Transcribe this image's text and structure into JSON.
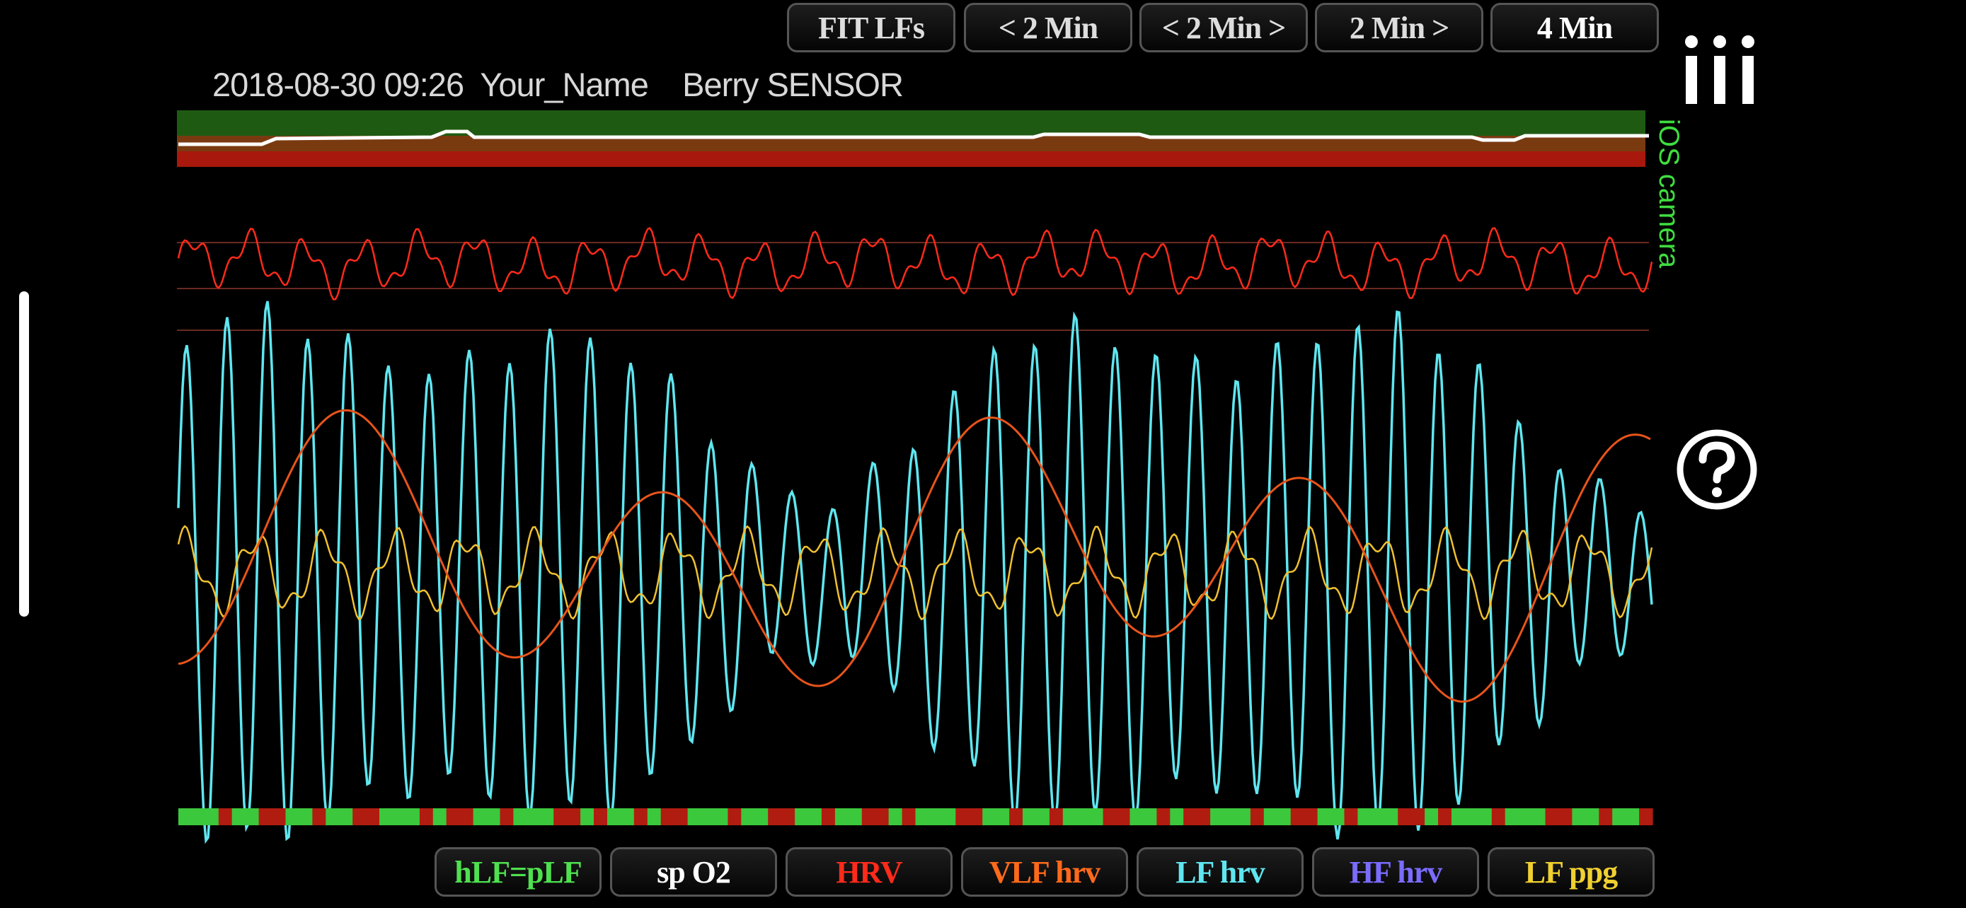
{
  "toolbar": {
    "buttons": [
      {
        "label": "FIT LFs",
        "color": "#dddddd"
      },
      {
        "label": "< 2 Min",
        "color": "#dddddd"
      },
      {
        "label": "< 2 Min >",
        "color": "#dddddd"
      },
      {
        "label": "2 Min >",
        "color": "#dddddd"
      },
      {
        "label": "4 Min",
        "color": "#ffffff"
      }
    ]
  },
  "header": {
    "timestamp": "2018-08-30 09:26",
    "user": "Your_Name",
    "sensor": "Berry SENSOR"
  },
  "side": {
    "camera_label": "iOS camera",
    "menu_icon": "menu-icon",
    "help_icon": "question-mark-icon"
  },
  "legend": {
    "buttons": [
      {
        "label": "hLF=pLF",
        "color": "#4fe04f"
      },
      {
        "label": "sp O2",
        "color": "#ffffff"
      },
      {
        "label": "HRV",
        "color": "#ff2a1a"
      },
      {
        "label": "VLF hrv",
        "color": "#ff6a1a"
      },
      {
        "label": "LF hrv",
        "color": "#5fe6f0"
      },
      {
        "label": "HF hrv",
        "color": "#7a6cff"
      },
      {
        "label": "LF ppg",
        "color": "#f0d030"
      }
    ]
  },
  "colors": {
    "spo2_band_green": "#1f5a12",
    "spo2_band_brown": "#7a3a10",
    "spo2_band_red": "#a8180c",
    "hrv": "#ff2a1a",
    "vlf": "#e8541a",
    "lf_hrv": "#5fe6f0",
    "lf_ppg": "#f0c030",
    "quality_good": "#3cc83c",
    "quality_bad": "#b01c10",
    "guide_line": "#6a2a22"
  },
  "chart_data": {
    "type": "line",
    "duration_min": 4,
    "quality_bar_pattern": [
      1,
      1,
      1,
      0,
      1,
      1,
      0,
      0,
      1,
      1,
      0,
      1,
      1,
      0,
      0,
      1,
      1,
      1,
      0,
      1,
      0,
      0,
      1,
      1,
      0,
      1,
      1,
      1,
      0,
      0,
      1,
      0,
      1,
      1,
      0,
      1,
      0,
      0,
      1,
      1,
      1,
      0,
      1,
      1,
      0,
      0,
      1,
      1,
      0,
      1,
      1,
      0,
      0,
      1,
      0,
      1,
      1,
      1,
      0,
      0,
      1,
      1,
      0,
      1,
      1,
      0,
      1,
      1,
      1,
      0,
      0,
      1,
      1,
      0,
      1,
      0,
      0,
      1,
      1,
      1,
      0,
      1,
      1,
      0,
      0,
      1,
      1,
      0,
      1,
      1,
      1,
      0,
      0,
      1,
      0,
      1,
      1,
      1,
      0,
      1,
      1,
      1,
      0,
      0,
      1,
      1,
      0,
      1,
      1,
      0
    ]
  }
}
